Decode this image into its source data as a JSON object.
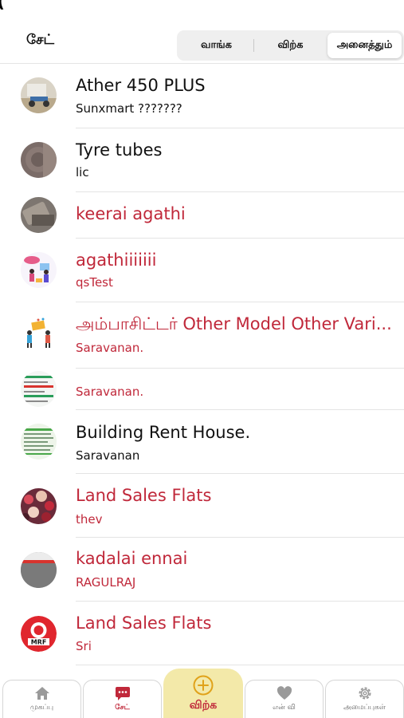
{
  "header": {
    "title": "சேட்",
    "segments": [
      "வாங்க",
      "விற்க",
      "அனைத்தும்"
    ],
    "active_segment": "அனைத்தும்"
  },
  "chats": [
    {
      "title": "Ather 450 PLUS",
      "subtitle": "Sunxmart ???????",
      "unread": false,
      "avatar": "scooter-photo"
    },
    {
      "title": "Tyre tubes",
      "subtitle": "lic",
      "unread": false,
      "avatar": "tyre-photo"
    },
    {
      "title": "keerai agathi",
      "subtitle": "",
      "unread": true,
      "avatar": "leaf-photo"
    },
    {
      "title": "agathiiiiiii",
      "subtitle": "qsTest",
      "unread": true,
      "avatar": "people-illustration"
    },
    {
      "title": "அம்பாசிட்டர் Other Model Other Vari...",
      "subtitle": "Saravanan.",
      "unread": true,
      "avatar": "celebration-illustration"
    },
    {
      "title": "",
      "subtitle": "Saravanan.",
      "unread": true,
      "avatar": "document-screenshot"
    },
    {
      "title": "Building Rent House.",
      "subtitle": "Saravanan",
      "unread": false,
      "avatar": "document-screenshot"
    },
    {
      "title": "Land Sales Flats",
      "subtitle": "thev",
      "unread": true,
      "avatar": "crowd-photo"
    },
    {
      "title": "kadalai ennai",
      "subtitle": "RAGULRAJ",
      "unread": true,
      "avatar": "grey-screenshot"
    },
    {
      "title": "Land Sales Flats",
      "subtitle": "Sri",
      "unread": true,
      "avatar": "mrf-logo"
    }
  ],
  "tabbar": {
    "home": "முகப்பு",
    "chat": "சேட்",
    "sell": "விற்க",
    "favorites": "என் வி",
    "settings": "அமைப்புகள்"
  },
  "colors": {
    "accent": "#c0283a",
    "sell_tab_bg": "#f3e9a9",
    "divider": "#e4e4e4"
  }
}
